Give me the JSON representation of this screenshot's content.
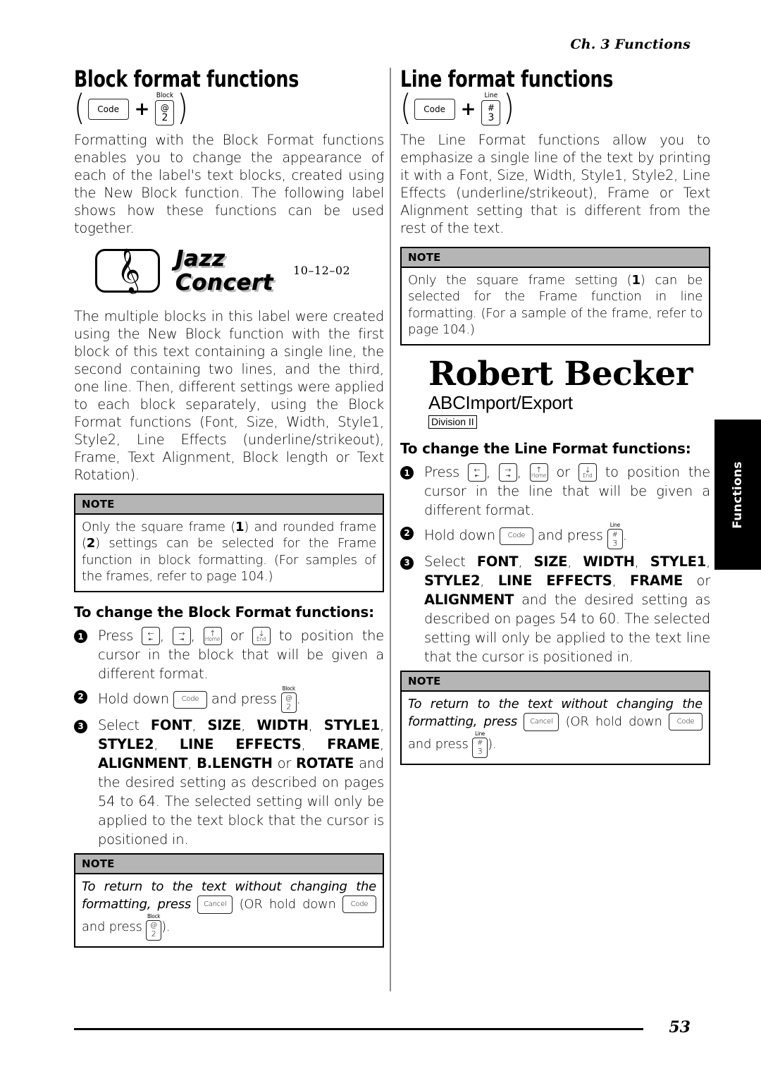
{
  "header": {
    "running_head": "Ch. 3 Functions"
  },
  "footer": {
    "page_number": "53"
  },
  "side_tab": {
    "label": "Functions"
  },
  "left_column": {
    "heading": "Block format functions",
    "shortcut": {
      "open_paren": "(",
      "key_code": "Code",
      "plus": "+",
      "key_cap": "Block",
      "key_top": "@",
      "key_bottom": "2",
      "close_paren": ")"
    },
    "intro": "Formatting with the Block Format functions enables you to change the appearance of each of the label's text blocks, created using the New Block function. The following label shows how these functions can be used together.",
    "label_sample": {
      "icon": "music-note-icon",
      "line1": "Jazz",
      "line2": "Concert",
      "date": "10–12–02"
    },
    "body2": "The multiple blocks in this label were created using the New Block function with the first block of this text containing a single line, the second containing two lines, and the third, one line. Then, different settings were applied to each block separately, using the Block Format functions (Font, Size, Width, Style1, Style2, Line Effects (underline/strikeout), Frame, Text Alignment, Block length or Text Rotation).",
    "note1": {
      "title": "NOTE",
      "text_a": "Only the square frame (",
      "bold_1": "1",
      "text_b": ") and rounded frame (",
      "bold_2": "2",
      "text_c": ") settings can be selected for the Frame function in block formatting. (For samples of the frames, refer to page 104.)"
    },
    "procedure_title": "To change the Block Format functions:",
    "steps": [
      {
        "num": "1",
        "pre": "Press",
        "sep1": ",",
        "sep2": ",",
        "or": "or",
        "post": "to position the cursor in the block that will be given a different format."
      },
      {
        "num": "2",
        "pre": "Hold down",
        "mid": "and press",
        "post": "."
      },
      {
        "num": "3",
        "pre": "Select",
        "bold_items": [
          "FONT",
          "SIZE",
          "WIDTH",
          "STYLE1",
          "STYLE2",
          "LINE EFFECTS",
          "FRAME",
          "ALIGNMENT",
          "B.LENGTH",
          "ROTATE"
        ],
        "text": "and the desired setting as described on pages 54 to 64. The selected setting will only be applied to the text block that the cursor is positioned in."
      }
    ],
    "note2": {
      "title": "NOTE",
      "text_a": "To return to the text without changing the formatting, press",
      "key_cancel": "Cancel",
      "text_b": "(OR hold down",
      "key_code": "Code",
      "text_c": "and press",
      "text_d": ")."
    }
  },
  "right_column": {
    "heading": "Line format functions",
    "shortcut": {
      "open_paren": "(",
      "key_code": "Code",
      "plus": "+",
      "key_cap": "Line",
      "key_top": "#",
      "key_bottom": "3",
      "close_paren": ")"
    },
    "intro": "The Line Format functions allow you to emphasize a single line of the text by printing it with a Font, Size, Width, Style1, Style2, Line Effects (underline/strikeout), Frame or Text Alignment setting that is different from the rest of the text.",
    "note1": {
      "title": "NOTE",
      "text_a": "Only the square frame setting (",
      "bold_1": "1",
      "text_b": ") can be selected for the Frame function in line formatting. (For a sample of the frame, refer to page 104.)"
    },
    "label_sample": {
      "name": "Robert Becker",
      "company": "ABCImport/Export",
      "division": "Division II"
    },
    "procedure_title": "To change the Line Format functions:",
    "steps": [
      {
        "num": "1",
        "pre": "Press",
        "sep1": ",",
        "sep2": ",",
        "or": "or",
        "post": "to position the cursor in the line that will be given a different format."
      },
      {
        "num": "2",
        "pre": "Hold down",
        "mid": "and press",
        "post": "."
      },
      {
        "num": "3",
        "pre": "Select",
        "bold_items": [
          "FONT",
          "SIZE",
          "WIDTH",
          "STYLE1",
          "STYLE2",
          "LINE EFFECTS",
          "FRAME",
          "ALIGNMENT"
        ],
        "text": "and the desired setting as described on pages 54 to 60. The selected setting will only be applied to the text line that the cursor is positioned in."
      }
    ],
    "note2": {
      "title": "NOTE",
      "text_a": "To return to the text without changing the formatting, press",
      "key_cancel": "Cancel",
      "text_b": "(OR hold down",
      "key_code": "Code",
      "text_c": "and press",
      "text_d": ")."
    }
  },
  "keys": {
    "arrow_left": {
      "glyph": "←",
      "sub": "⇤"
    },
    "arrow_right": {
      "glyph": "→",
      "sub": "⇥"
    },
    "home": {
      "glyph": "↑",
      "sub": "Home"
    },
    "end": {
      "glyph": "↓",
      "sub": "End"
    },
    "code": "Code",
    "cancel": "Cancel"
  }
}
